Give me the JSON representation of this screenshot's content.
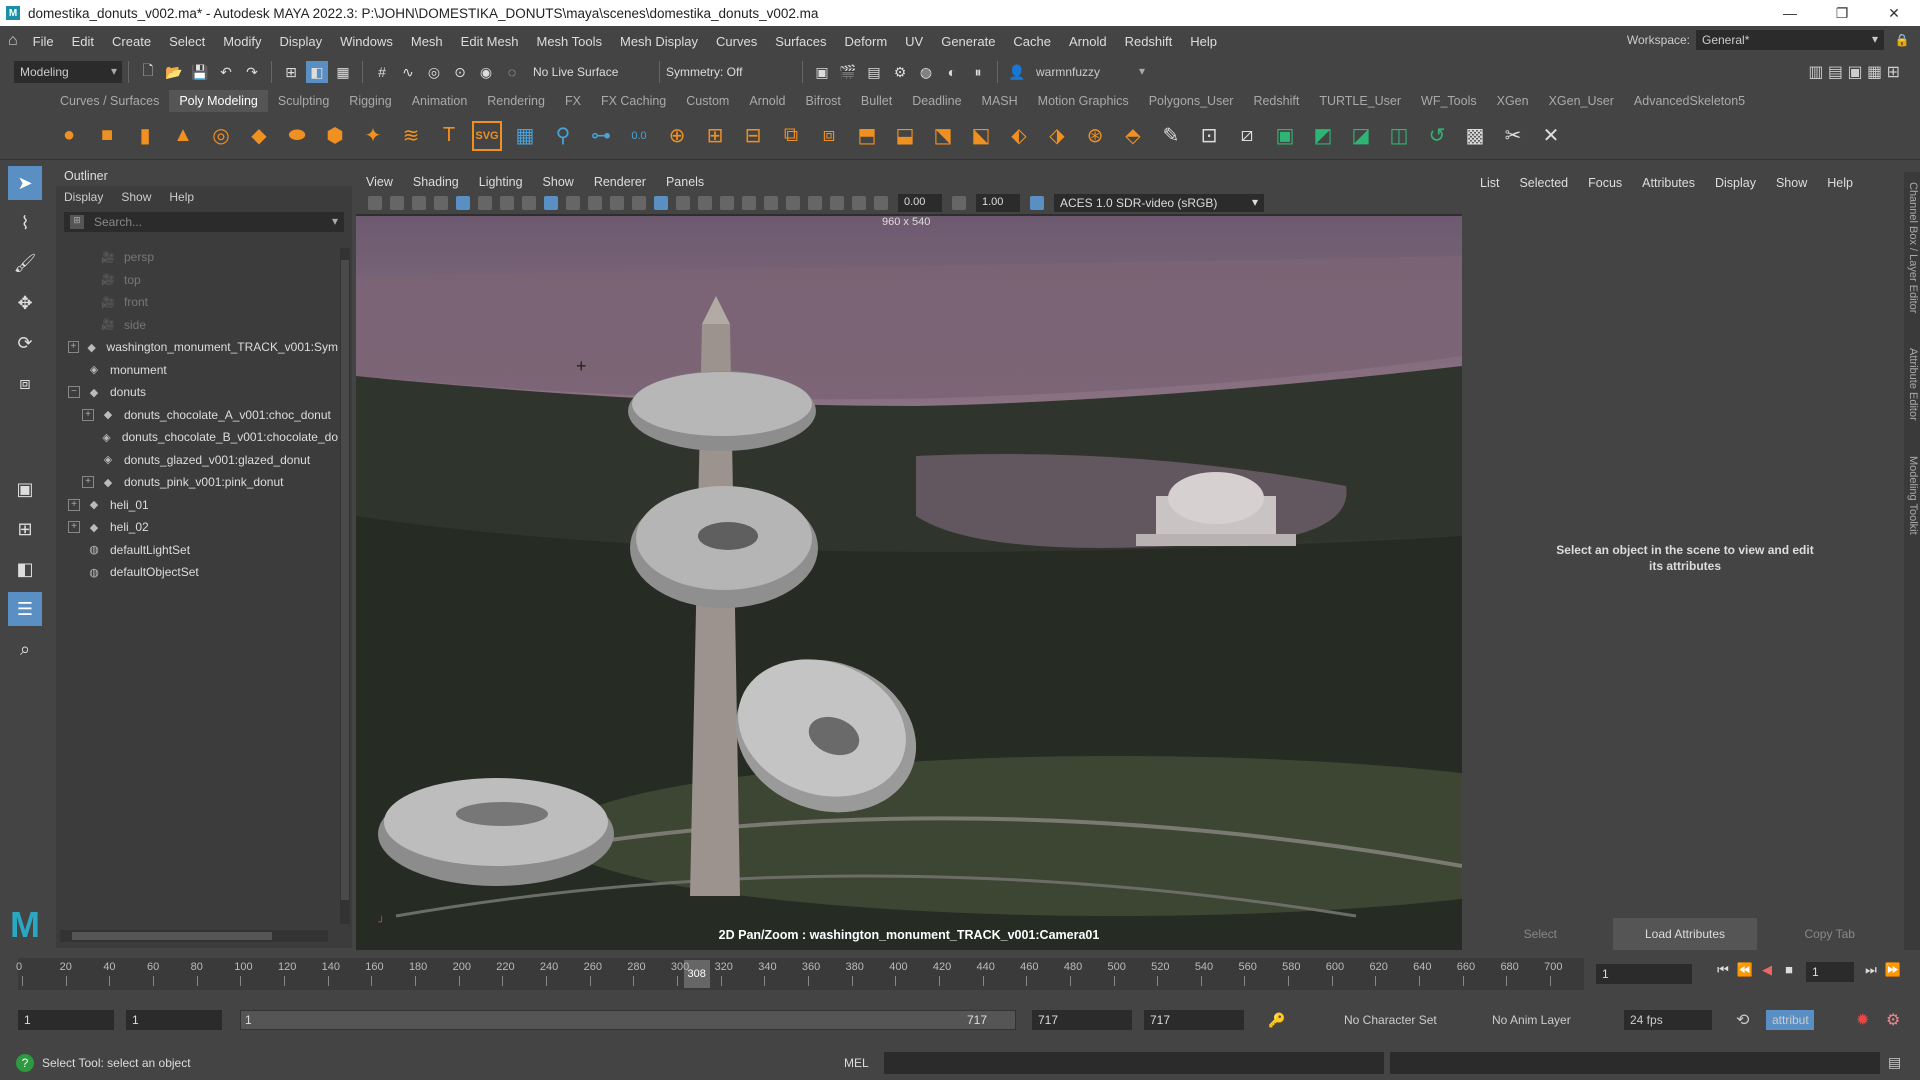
{
  "titlebar": {
    "title": "domestika_donuts_v002.ma* - Autodesk MAYA 2022.3: P:\\JOHN\\DOMESTIKA_DONUTS\\maya\\scenes\\domestika_donuts_v002.ma",
    "minimize": "—",
    "restore": "❐",
    "close": "✕"
  },
  "menubar": {
    "items": [
      "File",
      "Edit",
      "Create",
      "Select",
      "Modify",
      "Display",
      "Windows",
      "Mesh",
      "Edit Mesh",
      "Mesh Tools",
      "Mesh Display",
      "Curves",
      "Surfaces",
      "Deform",
      "UV",
      "Generate",
      "Cache",
      "Arnold",
      "Redshift",
      "Help"
    ],
    "workspace_label": "Workspace:",
    "workspace_value": "General*"
  },
  "statusline": {
    "mode": "Modeling",
    "live_surface": "No Live Surface",
    "symmetry": "Symmetry: Off",
    "user": "warmnfuzzy"
  },
  "shelf": {
    "tabs": [
      "Curves / Surfaces",
      "Poly Modeling",
      "Sculpting",
      "Rigging",
      "Animation",
      "Rendering",
      "FX",
      "FX Caching",
      "Custom",
      "Arnold",
      "Bifrost",
      "Bullet",
      "Deadline",
      "MASH",
      "Motion Graphics",
      "Polygons_User",
      "Redshift",
      "TURTLE_User",
      "WF_Tools",
      "XGen",
      "XGen_User",
      "AdvancedSkeleton5"
    ],
    "active_tab": "Poly Modeling",
    "text_icon": "T",
    "svg_icon": "SVG",
    "num_icon": "0.0"
  },
  "outliner": {
    "title": "Outliner",
    "menu": [
      "Display",
      "Show",
      "Help"
    ],
    "search_placeholder": "Search...",
    "nodes": [
      {
        "label": "persp",
        "indent": 1,
        "expander": false,
        "icon": "camera-icon",
        "dim": true
      },
      {
        "label": "top",
        "indent": 1,
        "expander": false,
        "icon": "camera-icon",
        "dim": true
      },
      {
        "label": "front",
        "indent": 1,
        "expander": false,
        "icon": "camera-icon",
        "dim": true
      },
      {
        "label": "side",
        "indent": 1,
        "expander": false,
        "icon": "camera-icon",
        "dim": true
      },
      {
        "label": "washington_monument_TRACK_v001:Sym",
        "indent": 0,
        "expander": "+",
        "icon": "transform-icon",
        "dim": false
      },
      {
        "label": "monument",
        "indent": 0,
        "expander": false,
        "icon": "mesh-icon",
        "dim": false
      },
      {
        "label": "donuts",
        "indent": 0,
        "expander": "−",
        "icon": "transform-icon",
        "dim": false
      },
      {
        "label": "donuts_chocolate_A_v001:choc_donut",
        "indent": 1,
        "expander": "+",
        "icon": "transform-icon",
        "dim": false
      },
      {
        "label": "donuts_chocolate_B_v001:chocolate_do",
        "indent": 1,
        "expander": false,
        "icon": "mesh-icon",
        "dim": false
      },
      {
        "label": "donuts_glazed_v001:glazed_donut",
        "indent": 1,
        "expander": false,
        "icon": "mesh-icon",
        "dim": false
      },
      {
        "label": "donuts_pink_v001:pink_donut",
        "indent": 1,
        "expander": "+",
        "icon": "transform-icon",
        "dim": false
      },
      {
        "label": "heli_01",
        "indent": 0,
        "expander": "+",
        "icon": "transform-icon",
        "dim": false
      },
      {
        "label": "heli_02",
        "indent": 0,
        "expander": "+",
        "icon": "transform-icon",
        "dim": false
      },
      {
        "label": "defaultLightSet",
        "indent": 0,
        "expander": false,
        "icon": "set-icon",
        "dim": false
      },
      {
        "label": "defaultObjectSet",
        "indent": 0,
        "expander": false,
        "icon": "set-icon",
        "dim": false
      }
    ]
  },
  "viewport": {
    "menu": [
      "View",
      "Shading",
      "Lighting",
      "Show",
      "Renderer",
      "Panels"
    ],
    "exposure": "0.00",
    "gamma": "1.00",
    "color_space": "ACES 1.0 SDR-video (sRGB)",
    "resolution": "960 x 540",
    "camera_label": "2D Pan/Zoom : washington_monument_TRACK_v001:Camera01"
  },
  "attribute_editor": {
    "menu": [
      "List",
      "Selected",
      "Focus",
      "Attributes",
      "Display",
      "Show",
      "Help"
    ],
    "message": "Select an object in the scene to view and edit its attributes",
    "buttons": [
      "Select",
      "Load Attributes",
      "Copy Tab"
    ]
  },
  "side_tabs": [
    "Channel Box / Layer Editor",
    "Attribute Editor",
    "Modeling Toolkit"
  ],
  "timeslider": {
    "labels": [
      "0",
      "20",
      "40",
      "60",
      "80",
      "100",
      "120",
      "140",
      "160",
      "180",
      "200",
      "220",
      "240",
      "260",
      "280",
      "300",
      "320",
      "340",
      "360",
      "380",
      "400",
      "420",
      "440",
      "460",
      "480",
      "500",
      "520",
      "540",
      "560",
      "580",
      "600",
      "620",
      "640",
      "660",
      "680",
      "700"
    ],
    "range_max": 717,
    "current_frame": "308",
    "current_frame_field": "1",
    "playback_frame": "1"
  },
  "rangeslider": {
    "start": "1",
    "anim_start": "1",
    "range_start": "1",
    "range_end": "717",
    "anim_end": "717",
    "end": "717",
    "character_set": "No Character Set",
    "anim_layer": "No Anim Layer",
    "fps": "24 fps",
    "attribute": "attribut"
  },
  "helpline": {
    "text": "Select Tool: select an object",
    "lang": "MEL"
  },
  "colors": {
    "accent": "#5a8fc3",
    "shelf_orange": "#f09020",
    "shelf_green": "#2fb573",
    "maya_logo": "#2aa8c2"
  }
}
